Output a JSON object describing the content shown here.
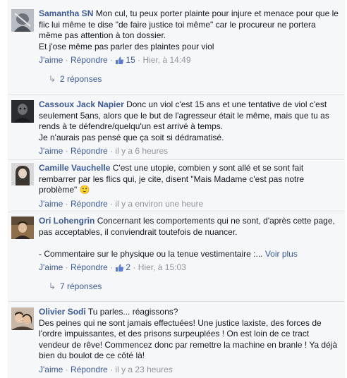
{
  "comments": [
    {
      "author": "Samantha SN",
      "text": "Mon cul, tu peux porter plainte pour injure et menace pour que le flic lui même te dise \"de faire justice toi même\" car le procureur ne portera même pas attention à ton dossier.",
      "text2": "Et j'ose même pas parler des plaintes pour viol",
      "like": "J'aime",
      "reply": "Répondre",
      "likes_count": "15",
      "time": "Hier, à 14:49",
      "replies": "2 réponses"
    },
    {
      "author": "Cassoux Jack Napier",
      "text": "Donc un viol c'est 15 ans et une tentative de viol c'est seulement 5ans, alors que le but de l'agresseur était le même, mais que tu as rends à te défendre/quelqu'un est arrivé à temps.",
      "text2": "Je n'aurais pas pensé que ça soit si dédramatisé.",
      "like": "J'aime",
      "reply": "Répondre",
      "time": "il y a 6 heures"
    },
    {
      "author": "Camille Vauchelle",
      "text": "C'est une utopie, combien y sont allé et se sont fait rembarrer par les flics qui, je cite, disent \"Mais Madame c'est pas notre problème\"",
      "emoji": "🙂",
      "like": "J'aime",
      "reply": "Répondre",
      "time": "il y a environ une heure"
    },
    {
      "author": "Ori Lohengrin",
      "text": "Concernant les comportements qui ne sont, d'après cette page, pas acceptables, il conviendrait toutefois de nuancer.",
      "text2": "- Commentaire sur le physique ou la tenue vestimentaire :...",
      "see_more": "Voir plus",
      "like": "J'aime",
      "reply": "Répondre",
      "likes_count": "2",
      "time": "Hier, à 15:03",
      "replies": "7 réponses"
    },
    {
      "author": "Olivier Sodi",
      "text": "Tu parles... réagissons?",
      "text2": "Des peines qui ne sont jamais effectuées! Une justice laxiste, des forces de l'ordre impuissantes, et des prisons surpeuplées ! On est loin de ce tract vendeur de rêve! Commencez donc par remettre la machine en branle ! Ya déjà bien du boulot de ce côté là!",
      "like": "J'aime",
      "reply": "Répondre",
      "time": "il y a 23 heures"
    }
  ],
  "separator": "·",
  "colors": {
    "link": "#3b5998",
    "meta": "#90949c",
    "background": "#f6f7f8",
    "text": "#141823"
  },
  "icons": {
    "like": "thumbs-up-icon",
    "replies": "reply-arrow-icon"
  }
}
